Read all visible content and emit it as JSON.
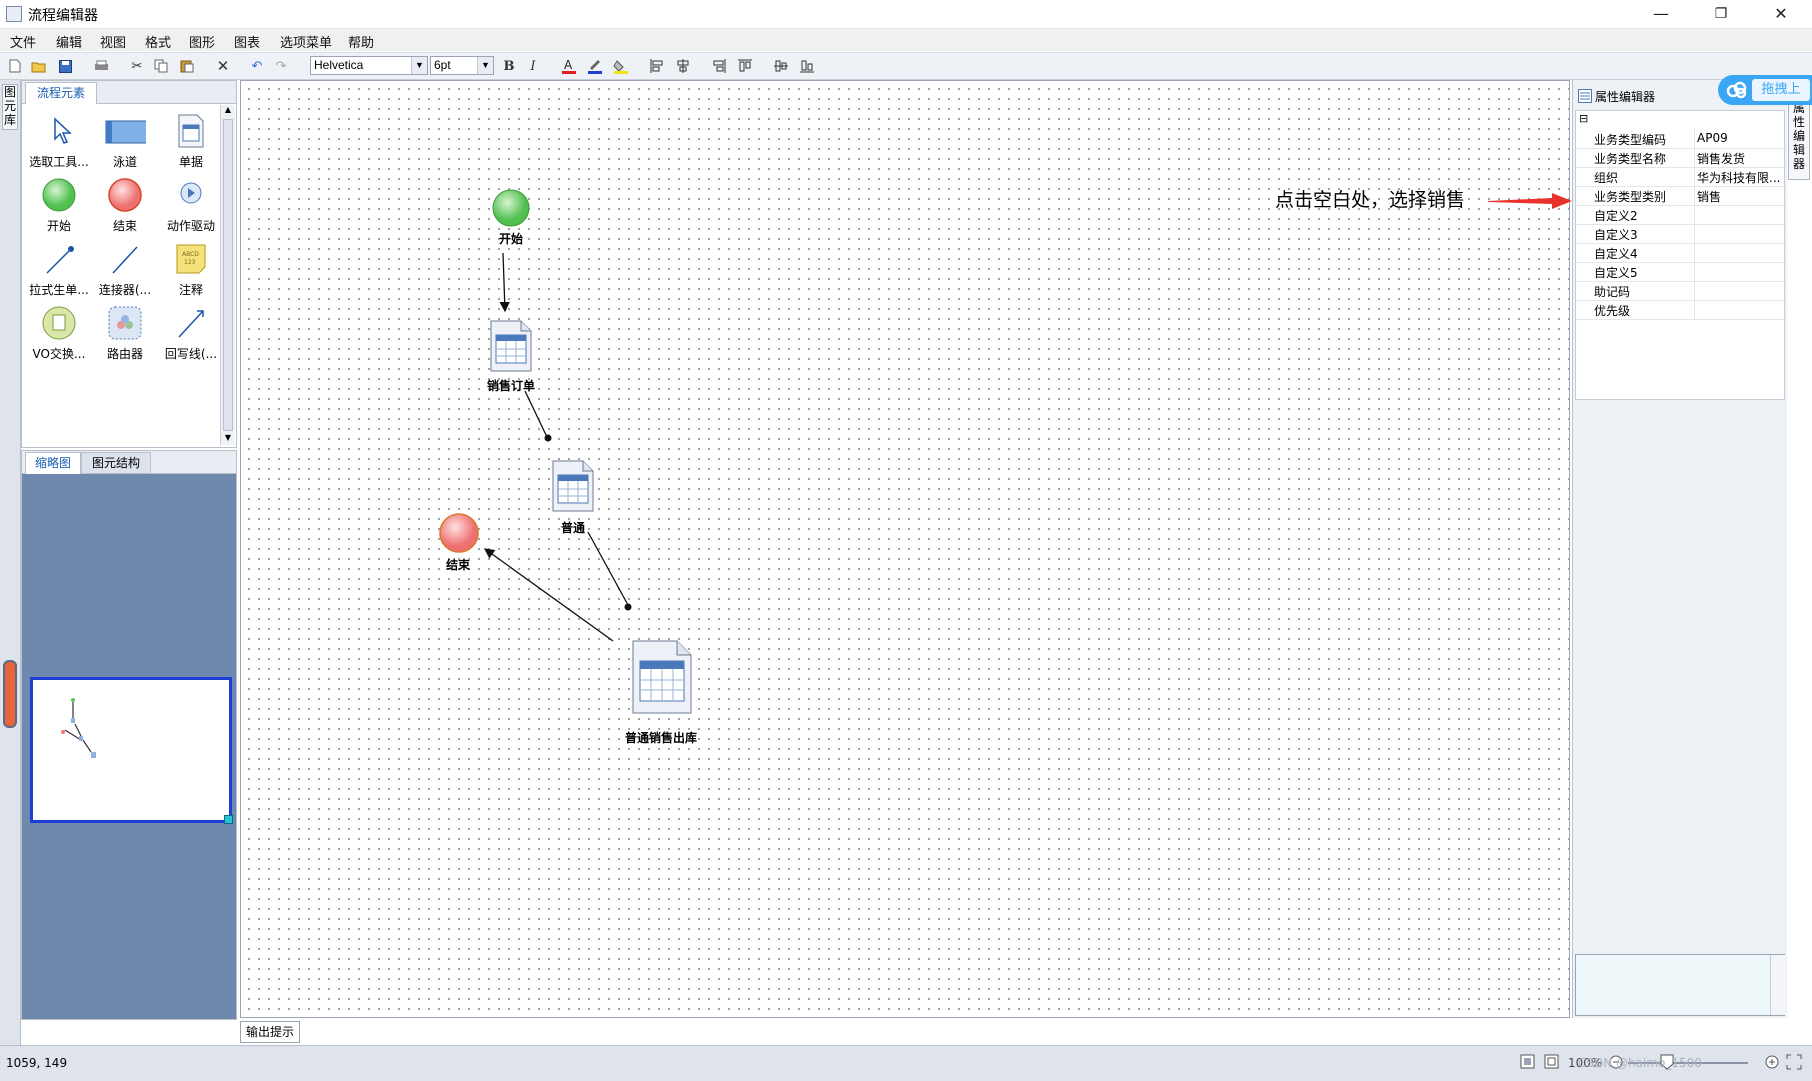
{
  "window": {
    "title": "流程编辑器",
    "minimize": "—",
    "maximize": "❐",
    "close": "✕"
  },
  "menu": [
    "文件",
    "编辑",
    "视图",
    "格式",
    "图形",
    "图表",
    "选项菜单",
    "帮助"
  ],
  "toolbar": {
    "font": "Helvetica",
    "size": "6pt",
    "bold": "B",
    "italic": "I"
  },
  "left_strip": {
    "tab": "图元库"
  },
  "palette": {
    "tab": "流程元素",
    "items": [
      {
        "label": "选取工具...",
        "icon": "pointer-icon"
      },
      {
        "label": "泳道",
        "icon": "swimlane-icon"
      },
      {
        "label": "单据",
        "icon": "document-icon"
      },
      {
        "label": "开始",
        "icon": "start-circle-icon"
      },
      {
        "label": "结束",
        "icon": "end-circle-icon"
      },
      {
        "label": "动作驱动",
        "icon": "action-drive-icon"
      },
      {
        "label": "拉式生单...",
        "icon": "pull-connector-icon"
      },
      {
        "label": "连接器(...",
        "icon": "connector-icon"
      },
      {
        "label": "注释",
        "icon": "note-icon"
      },
      {
        "label": "VO交换...",
        "icon": "vo-exchange-icon"
      },
      {
        "label": "路由器",
        "icon": "router-icon"
      },
      {
        "label": "回写线(...",
        "icon": "writeback-line-icon"
      }
    ]
  },
  "overview": {
    "tabs": [
      "缩略图",
      "图元结构"
    ]
  },
  "canvas": {
    "nodes": [
      {
        "id": "start",
        "label": "开始",
        "type": "start"
      },
      {
        "id": "sales_order",
        "label": "销售订单",
        "type": "document"
      },
      {
        "id": "normal",
        "label": "普通",
        "type": "document"
      },
      {
        "id": "end",
        "label": "结束",
        "type": "end"
      },
      {
        "id": "sales_out",
        "label": "普通销售出库",
        "type": "document"
      }
    ],
    "output_tab": "输出提示"
  },
  "annotation": {
    "text": "点击空白处，选择销售",
    "color": "#e8322b"
  },
  "properties": {
    "title": "属性编辑器",
    "collapse": "⊟",
    "rows": [
      {
        "key": "业务类型编码",
        "value": "AP09"
      },
      {
        "key": "业务类型名称",
        "value": "销售发货"
      },
      {
        "key": "组织",
        "value": "华为科技有限..."
      },
      {
        "key": "业务类型类别",
        "value": "销售"
      },
      {
        "key": "自定义2",
        "value": ""
      },
      {
        "key": "自定义3",
        "value": ""
      },
      {
        "key": "自定义4",
        "value": ""
      },
      {
        "key": "自定义5",
        "value": ""
      },
      {
        "key": "助记码",
        "value": ""
      },
      {
        "key": "优先级",
        "value": ""
      }
    ]
  },
  "right_strip": {
    "tab": "属性编辑器"
  },
  "baidu_button": {
    "label": "拖拽上"
  },
  "status": {
    "coords": "1059, 149",
    "zoom": "100%",
    "watermark": "CSDN @haimo_1500"
  },
  "colors": {
    "start": "#5cc85c",
    "end": "#f07c7c",
    "selection": "#1e3dd6",
    "overview_bg": "#6e89ad"
  }
}
